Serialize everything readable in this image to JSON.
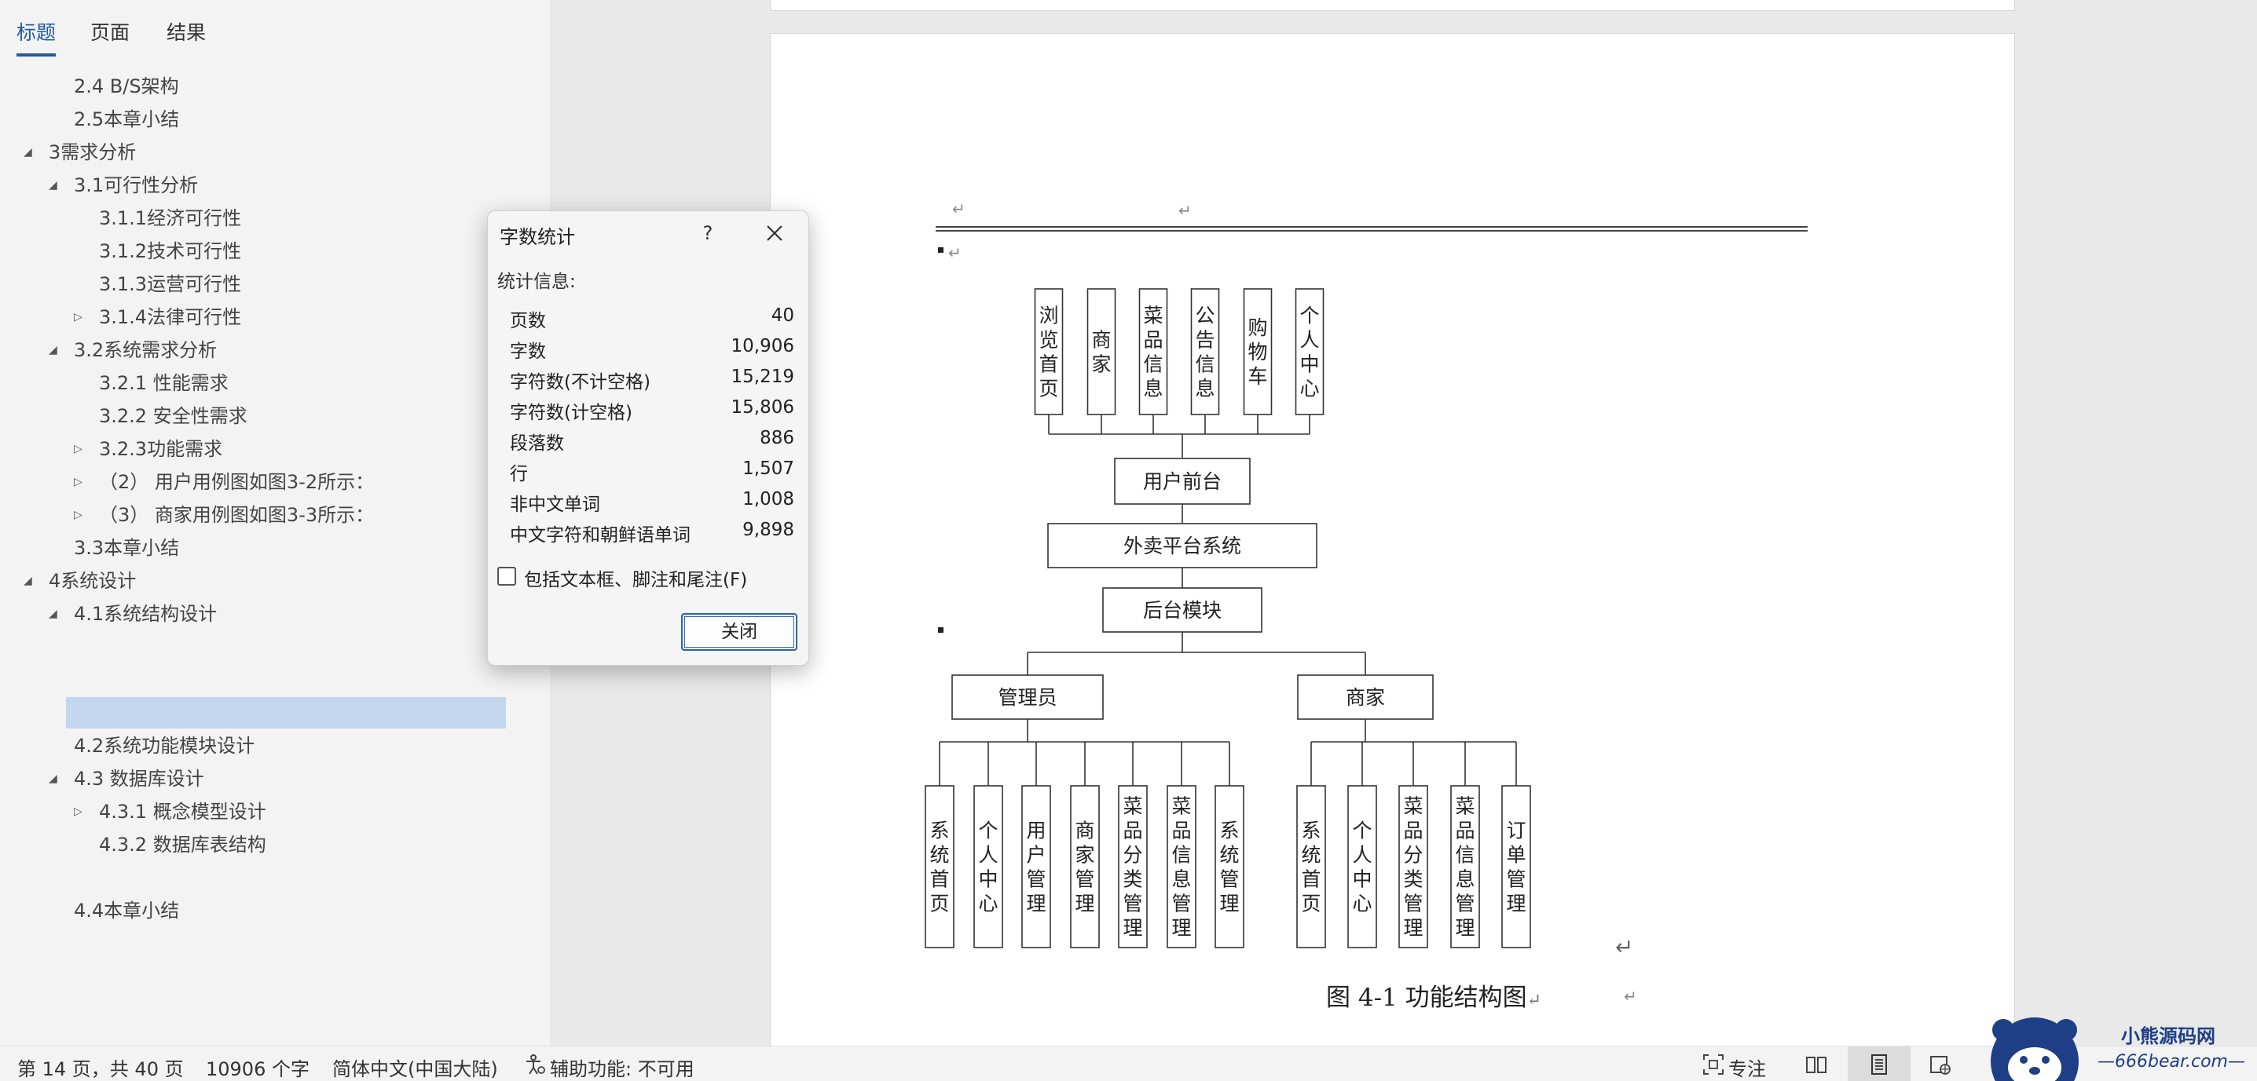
{
  "nav": {
    "tabs": [
      "标题",
      "页面",
      "结果"
    ],
    "items": [
      "2.4 B/S架构",
      "2.5本章小结",
      "3需求分析",
      "3.1可行性分析",
      "3.1.1经济可行性",
      "3.1.2技术可行性",
      "3.1.3运营可行性",
      "3.1.4法律可行性",
      "3.2系统需求分析",
      "3.2.1 性能需求",
      "3.2.2 安全性需求",
      "3.2.3功能需求",
      "（2） 用户用例图如图3-2所示：",
      "（3） 商家用例图如图3-3所示：",
      "3.3本章小结",
      "4系统设计",
      "4.1系统结构设计",
      "",
      "4.2系统功能模块设计",
      "4.3 数据库设计",
      "4.3.1 概念模型设计",
      "4.3.2 数据库表结构",
      "4.4本章小结"
    ]
  },
  "dialog": {
    "title": "字数统计",
    "help": "?",
    "heading": "统计信息:",
    "stats": [
      {
        "label": "页数",
        "value": "40"
      },
      {
        "label": "字数",
        "value": "10,906"
      },
      {
        "label": "字符数(不计空格)",
        "value": "15,219"
      },
      {
        "label": "字符数(计空格)",
        "value": "15,806"
      },
      {
        "label": "段落数",
        "value": "886"
      },
      {
        "label": "行",
        "value": "1,507"
      },
      {
        "label": "非中文单词",
        "value": "1,008"
      },
      {
        "label": "中文字符和朝鲜语单词",
        "value": "9,898"
      }
    ],
    "include_label": "包括文本框、脚注和尾注(F)",
    "include_checked": false,
    "close_label": "关闭"
  },
  "document": {
    "diagram": {
      "front_modules": [
        "浏览首页",
        "商家",
        "菜品信息",
        "公告信息",
        "购物车",
        "个人中心"
      ],
      "frontend": "用户前台",
      "system": "外卖平台系统",
      "backend": "后台模块",
      "admin": "管理员",
      "merchant": "商家",
      "admin_modules": [
        "系统首页",
        "个人中心",
        "用户管理",
        "商家管理",
        "菜品分类管理",
        "菜品信息管理",
        "系统管理"
      ],
      "merchant_modules": [
        "系统首页",
        "个人中心",
        "菜品分类管理",
        "菜品信息管理",
        "订单管理"
      ]
    },
    "caption": "图 4-1 功能结构图",
    "return_mark": "↵"
  },
  "statusbar": {
    "page": "第 14 页，共 40 页",
    "words": "10906 个字",
    "language": "简体中文(中国大陆)",
    "accessibility": "辅助功能: 不可用",
    "focus": "专注"
  },
  "watermark": {
    "line1": "小熊源码网",
    "line2": "—666bear.com—"
  },
  "colors": {
    "accent": "#1e5aa8",
    "nav_selected": "#c5d6ef",
    "pane_bg": "#f3f3f3"
  }
}
